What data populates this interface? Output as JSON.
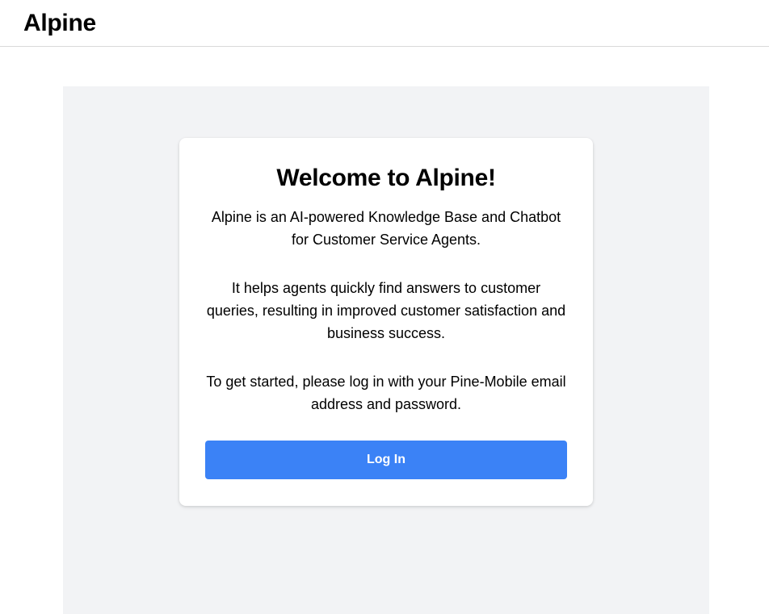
{
  "header": {
    "app_title": "Alpine"
  },
  "welcome": {
    "title": "Welcome to Alpine!",
    "paragraph_1": "Alpine is an AI-powered Knowledge Base and Chatbot for Customer Service Agents.",
    "paragraph_2": "It helps agents quickly find answers to customer queries, resulting in improved customer satisfaction and business success.",
    "paragraph_3": "To get started, please log in with your Pine-Mobile email address and password.",
    "login_label": "Log In"
  },
  "colors": {
    "accent": "#3b82f6",
    "panel_background": "#f2f3f5"
  }
}
